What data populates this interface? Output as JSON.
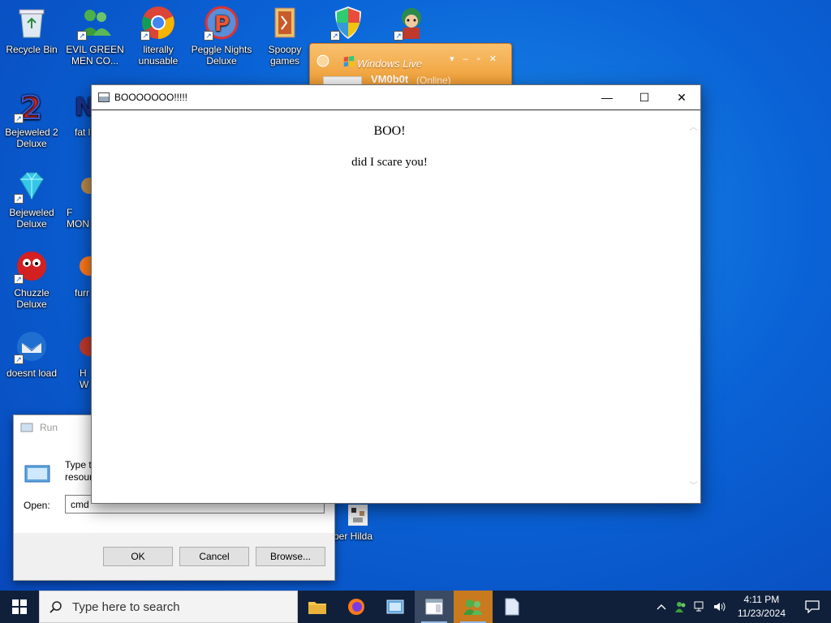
{
  "desktop": {
    "icons": [
      {
        "label": "Recycle Bin"
      },
      {
        "label": "EVIL GREEN MEN CO..."
      },
      {
        "label": "literally unusable"
      },
      {
        "label": "Peggle Nights Deluxe"
      },
      {
        "label": "Spoopy games"
      },
      {
        "label": "Bejeweled 2 Deluxe"
      },
      {
        "label": "fat lik"
      },
      {
        "label": "Bejeweled Deluxe"
      },
      {
        "label": "F MON"
      },
      {
        "label": "Chuzzle Deluxe"
      },
      {
        "label": "furr"
      },
      {
        "label": "doesnt load"
      },
      {
        "label": "H W"
      },
      {
        "label": "per Hilda"
      }
    ]
  },
  "wlm": {
    "title": "Windows Live",
    "user": "VM0b0t",
    "status": "(Online)",
    "controls": "▾ – ▫ ✕"
  },
  "run_dialog": {
    "title": "Run",
    "description_line1": "Type t",
    "description_line2": "resour",
    "open_label": "Open:",
    "open_value": "cmd",
    "ok_label": "OK",
    "cancel_label": "Cancel",
    "browse_label": "Browse..."
  },
  "boo_window": {
    "title": "BOOOOOOO!!!!!",
    "heading": "BOO!",
    "body": "did I scare you!",
    "minimize": "—",
    "maximize": "☐",
    "close": "✕"
  },
  "taskbar": {
    "search_placeholder": "Type here to search",
    "time": "4:11 PM",
    "date": "11/23/2024"
  },
  "colors": {
    "desktop_blue": "#0a63d6",
    "taskbar": "#10203a",
    "wlm_orange": "#f19a2c"
  }
}
